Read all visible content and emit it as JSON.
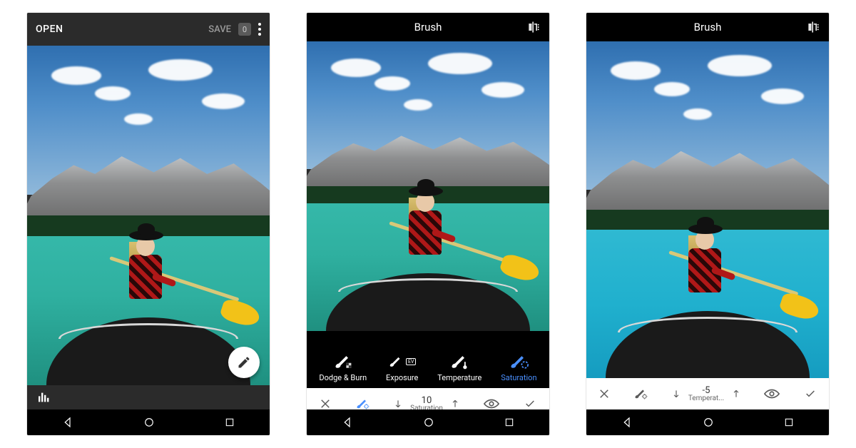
{
  "phone1": {
    "open_label": "OPEN",
    "save_label": "SAVE",
    "edit_count": "0"
  },
  "phone2": {
    "title": "Brush",
    "tools": [
      {
        "label": "Dodge & Burn"
      },
      {
        "label": "Exposure",
        "badge": "EV"
      },
      {
        "label": "Temperature"
      },
      {
        "label": "Saturation"
      }
    ],
    "active_tool_index": 3,
    "slider": {
      "value": "10",
      "name": "Saturation"
    }
  },
  "phone3": {
    "title": "Brush",
    "slider": {
      "value": "-5",
      "name": "Temperat..."
    }
  },
  "icons": {
    "kebab": "more-vert",
    "compare": "compare",
    "histogram": "histogram",
    "pencil": "edit",
    "close": "close",
    "brush_settings": "brush-settings",
    "arrow_down": "arrow-down",
    "arrow_up": "arrow-up",
    "eye": "visibility",
    "check": "check",
    "nav_back": "back",
    "nav_home": "home",
    "nav_recent": "recent"
  }
}
